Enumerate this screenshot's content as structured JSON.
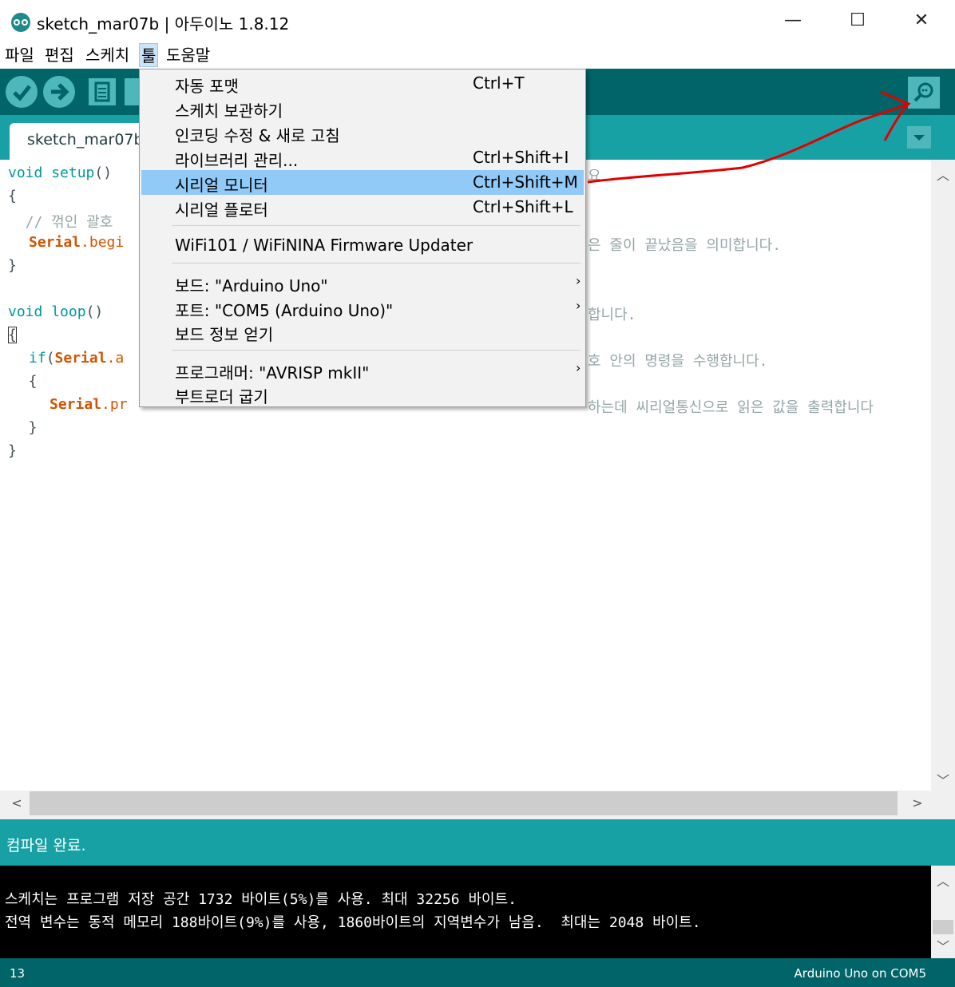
{
  "window": {
    "title": "sketch_mar07b | 아두이노 1.8.12",
    "minimize": "—",
    "maximize": "☐",
    "close": "✕"
  },
  "menubar": {
    "items": [
      "파일",
      "편집",
      "스케치",
      "툴",
      "도움말"
    ]
  },
  "toolbar": {
    "verify_icon": "check-icon",
    "upload_icon": "arrow-right-icon",
    "new_icon": "document-icon",
    "open_icon": "up-arrow-icon",
    "serial_monitor_icon": "magnifier-icon"
  },
  "tab": {
    "label": "sketch_mar07b"
  },
  "editor": {
    "lines": [
      {
        "kw": "void",
        "fn": "setup",
        "rest": "()"
      },
      {
        "text": "{"
      },
      {
        "comment": "  // 꺾인 괄호"
      },
      {
        "serial": "Serial",
        "fn": ".begi"
      },
      {
        "text": "}"
      },
      {
        "text": ""
      },
      {
        "kw": "void",
        "fn": "loop",
        "rest": "()"
      },
      {
        "text": "{"
      },
      {
        "kw": "if",
        "rest": "(",
        "serial": "Serial",
        "fn": ".a"
      },
      {
        "text": "  {"
      },
      {
        "serial": "Serial",
        "fn": ".pr"
      },
      {
        "text": "  }"
      },
      {
        "text": "}"
      }
    ],
    "visible_right_fragments": [
      "요",
      "은 줄이 끝났음을 의미합니다.",
      "합니다.",
      "호 안의 명령을 수행합니다.",
      "하는데 씨리얼통신으로 읽은 값을 출력합니다"
    ]
  },
  "status": {
    "text": "컴파일 완료."
  },
  "console": {
    "lines": [
      "스케치는 프로그램 저장 공간 1732 바이트(5%)를 사용. 최대 32256 바이트.",
      "전역 변수는 동적 메모리 188바이트(9%)를 사용, 1860바이트의 지역변수가 남음.  최대는 2048 바이트."
    ]
  },
  "footer": {
    "line": "13",
    "board": "Arduino Uno on COM5"
  },
  "tools_menu": {
    "items": [
      {
        "label": "자동 포맷",
        "shortcut": "Ctrl+T"
      },
      {
        "label": "스케치 보관하기",
        "shortcut": ""
      },
      {
        "label": "인코딩 수정 & 새로 고침",
        "shortcut": ""
      },
      {
        "label": "라이브러리 관리...",
        "shortcut": "Ctrl+Shift+I"
      },
      {
        "label": "시리얼 모니터",
        "shortcut": "Ctrl+Shift+M",
        "highlighted": true
      },
      {
        "label": "시리얼 플로터",
        "shortcut": "Ctrl+Shift+L"
      },
      {
        "label": "WiFi101 / WiFiNINA Firmware Updater",
        "shortcut": ""
      },
      {
        "label": "보드: \"Arduino Uno\"",
        "submenu": true
      },
      {
        "label": "포트: \"COM5 (Arduino Uno)\"",
        "submenu": true
      },
      {
        "label": "보드 정보 얻기",
        "shortcut": ""
      },
      {
        "label": "프로그래머: \"AVRISP mkII\"",
        "submenu": true
      },
      {
        "label": "부트로더 굽기",
        "shortcut": ""
      }
    ]
  },
  "colors": {
    "toolbar": "#006468",
    "tabbar": "#17a1a5",
    "button": "#4db7bb",
    "highlight": "#91c9f7",
    "annotation": "#e00000"
  }
}
